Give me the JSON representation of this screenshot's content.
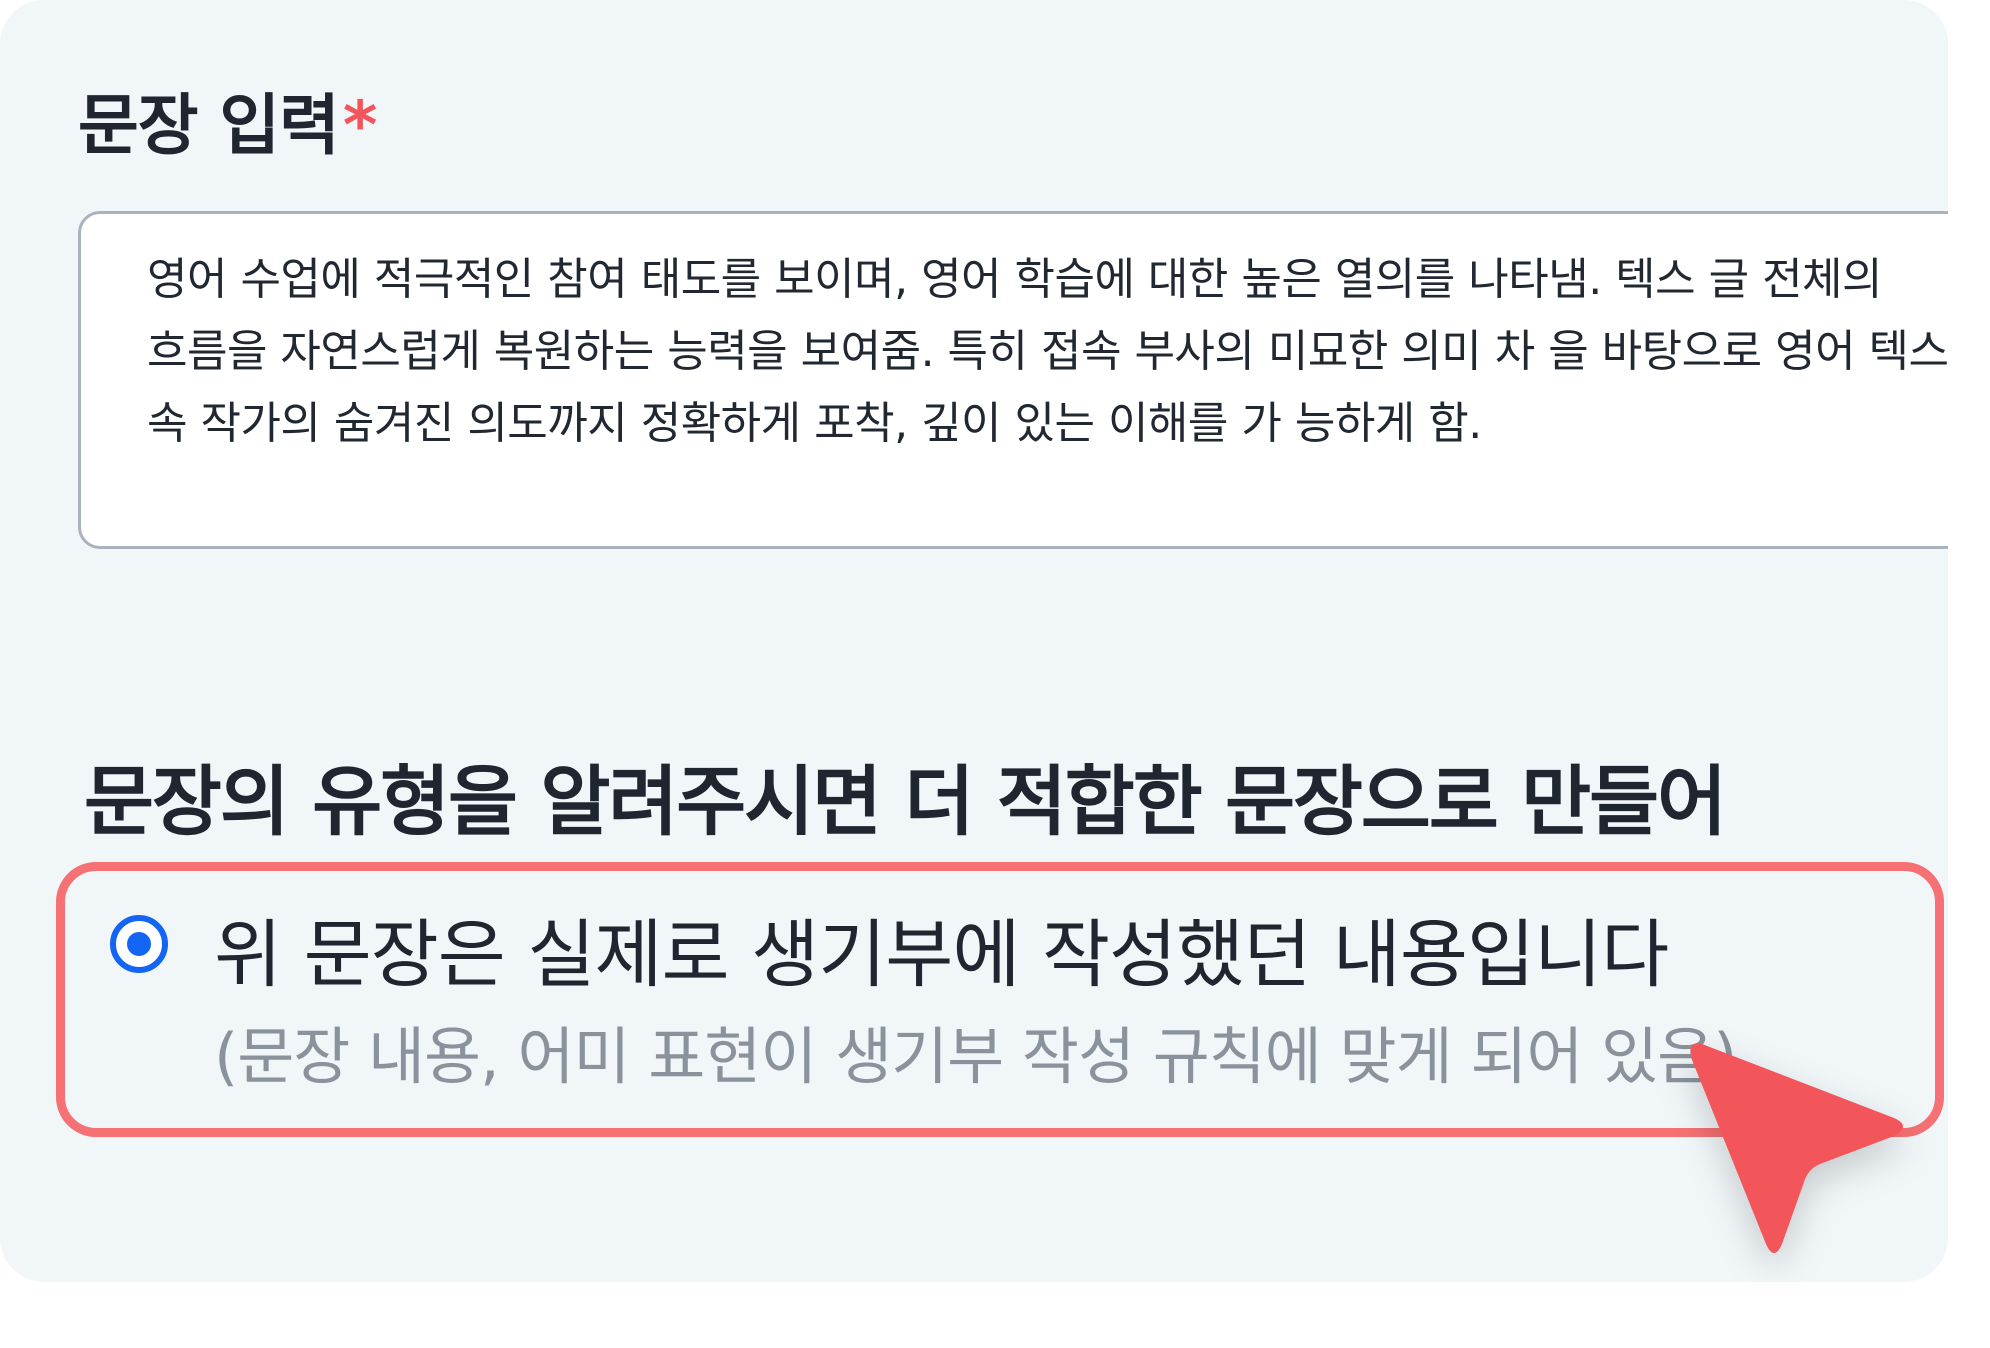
{
  "form": {
    "field_label": "문장 입력",
    "required_mark": "*",
    "textarea_value": "영어 수업에 적극적인 참여 태도를 보이며, 영어 학습에 대한 높은 열의를 나타냄. 텍스 글 전체의 흐름을 자연스럽게 복원하는 능력을 보여줌. 특히 접속 부사의 미묘한 의미 차 을 바탕으로 영어 텍스트 속 작가의 숨겨진 의도까지 정확하게 포착, 깊이 있는 이해를 가 능하게 함."
  },
  "section": {
    "title": "문장의 유형을 알려주시면 더 적합한 문장으로 만들어"
  },
  "option": {
    "label": "위 문장은 실제로 생기부에 작성했던 내용입니다",
    "sublabel": "(문장 내용, 어미 표현이 생기부 작성 규칙에 맞게 되어 있음)",
    "selected": true
  },
  "colors": {
    "accent": "#1565f5",
    "highlight_border": "#f57173",
    "cursor": "#f2555a",
    "required": "#f2555a",
    "background": "#f1f6f9"
  },
  "icons": {
    "radio": "radio-selected-icon",
    "cursor": "pointer-cursor-icon"
  }
}
